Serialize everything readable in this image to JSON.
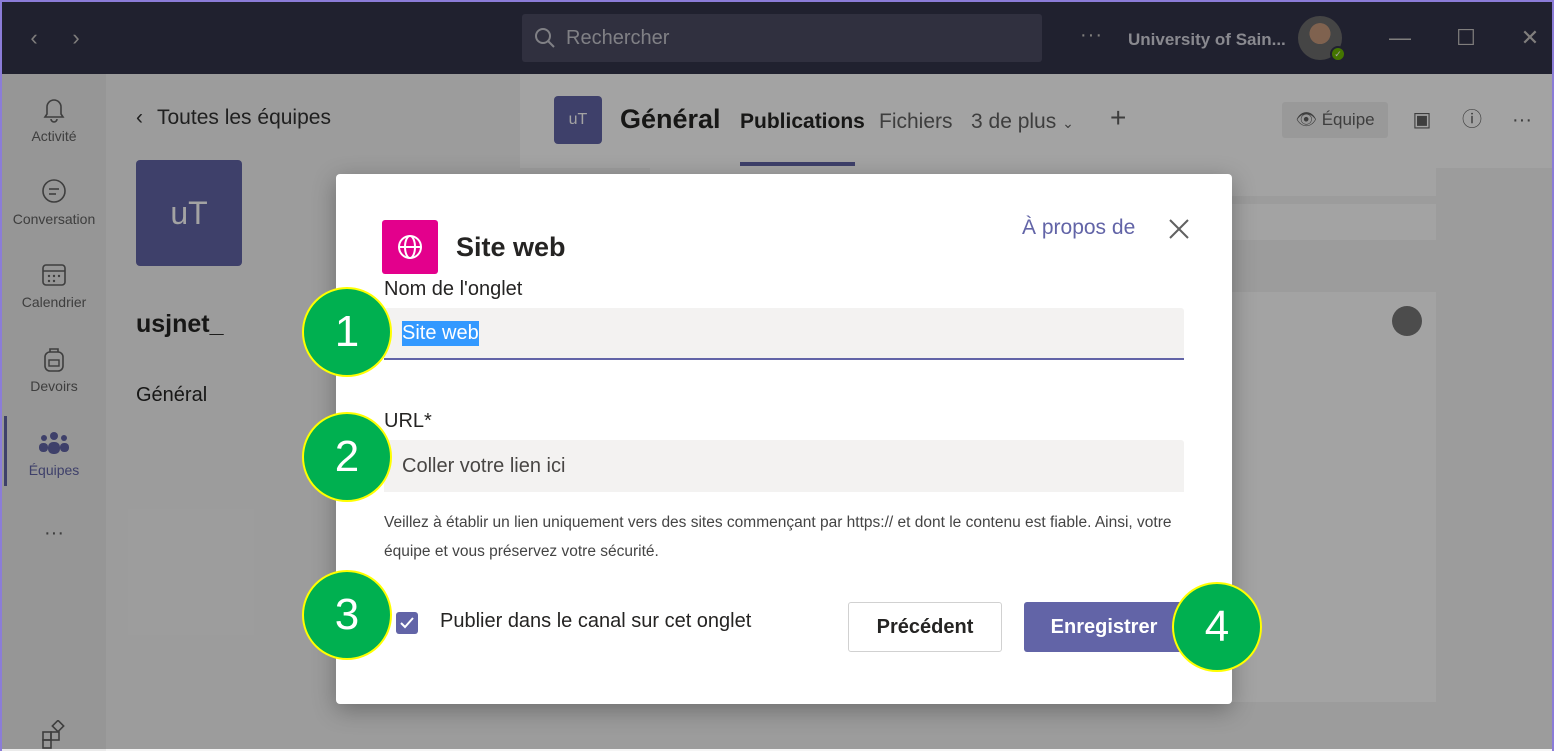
{
  "titlebar": {
    "search_placeholder": "Rechercher",
    "more_dots": "···",
    "org_name": "University of Sain..."
  },
  "rail": {
    "items": [
      {
        "label": "Activité",
        "icon": "bell-icon"
      },
      {
        "label": "Conversation",
        "icon": "chat-icon"
      },
      {
        "label": "Calendrier",
        "icon": "calendar-icon"
      },
      {
        "label": "Devoirs",
        "icon": "backpack-icon"
      },
      {
        "label": "Équipes",
        "icon": "teams-icon",
        "active": true
      }
    ],
    "more": "···"
  },
  "teams_panel": {
    "back_label": "Toutes les équipes",
    "team_initials": "uT",
    "team_name": "usjnet_",
    "channel": "Général"
  },
  "channel_header": {
    "tile_initials": "uT",
    "channel_name": "Général",
    "tabs": [
      "Publications",
      "Fichiers",
      "3 de plus"
    ],
    "active_tab": "Publications",
    "team_button": "Équipe"
  },
  "dialog": {
    "title": "Site web",
    "about_link": "À propos de",
    "tab_name_label": "Nom de l'onglet",
    "tab_name_value": "Site web",
    "url_label": "URL*",
    "url_placeholder": "Coller votre lien ici",
    "help_text": "Veillez à établir un lien uniquement vers des sites commençant par https:// et dont le contenu est fiable. Ainsi, votre équipe et vous préservez votre sécurité.",
    "checkbox_label": "Publier dans le canal sur cet onglet",
    "checkbox_checked": true,
    "prev_button": "Précédent",
    "save_button": "Enregistrer"
  },
  "callouts": [
    "1",
    "2",
    "3",
    "4"
  ],
  "colors": {
    "accent": "#6264a7",
    "titlebar": "#33344a",
    "app_icon": "#e3008c",
    "callout_fill": "#00b050",
    "callout_border": "#ffff00"
  }
}
